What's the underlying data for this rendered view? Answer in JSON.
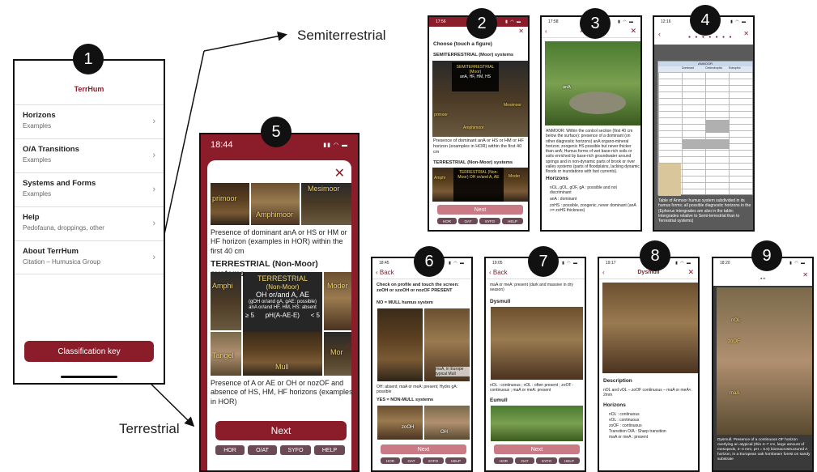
{
  "captions": {
    "semiterrestrial": "Semiterrestrial",
    "terrestrial": "Terrestrial"
  },
  "badges": [
    "1",
    "2",
    "3",
    "4",
    "5",
    "6",
    "7",
    "8",
    "9"
  ],
  "phone1": {
    "app_title": "TerrHum",
    "menu": [
      {
        "title": "Horizons",
        "subtitle": "Examples"
      },
      {
        "title": "O/A Transitions",
        "subtitle": "Examples"
      },
      {
        "title": "Systems and Forms",
        "subtitle": "Examples"
      },
      {
        "title": "Help",
        "subtitle": "Pedofauna, droppings, other"
      },
      {
        "title": "About TerrHum",
        "subtitle": "Citation – Humusica Group"
      }
    ],
    "classification_button": "Classification key"
  },
  "phone5": {
    "time": "18:44",
    "photo_labels": {
      "primoor": "primoor",
      "amphimoor": "Amphimoor",
      "mesimoor": "Mesimoor"
    },
    "moor_caption": "Presence of dominant anA or HS or HM or HF horizon (examples in HOR) within the first 40 cm",
    "terrestrial_title": "TERRESTRIAL (Non-Moor) systems",
    "overlay": {
      "l1": "TERRESTRIAL",
      "l2": "(Non-Moor)",
      "l3": "OH or/and A, AE",
      "l4": "(gOH or/and gA, gAE: possible)",
      "l5": "anA or/and HF, HM, HS: absent",
      "l6a": "≥ 5",
      "l6b": "pH(A-AE-E)",
      "l6c": "< 5"
    },
    "terr_labels": {
      "amphi": "Amphi",
      "moder": "Moder",
      "tangel": "Tangel",
      "mull": "Mull",
      "mor": "Mor"
    },
    "terr_caption": "Presence of A or AE or OH or nozOF and absence of HS, HM, HF horizons (examples in HOR)",
    "next_label": "Next",
    "tabs": [
      "HOR",
      "O/AT",
      "SYFO",
      "HELP"
    ]
  },
  "phone2": {
    "time": "17:56",
    "choose": "Choose (touch a figure)",
    "semi_title": "SEMITERRESTRIAL (Moor) systems",
    "overlay": "SEMITERRESTRIAL (Moor)",
    "overlay_sub": "anA, HF, HM, HS",
    "moor_caption": "Presence of dominant anA or HS or HM or HF horizon (examples in HOR) within the first 40 cm",
    "terr_title": "TERRESTRIAL (Non-Moor) systems",
    "terr_overlay": "TERRESTRIAL (Non-Moor) OH or/and A, AE",
    "labels": {
      "amphi": "Amphi",
      "moder": "Moder",
      "mor": "Mor",
      "primoor": "primoor",
      "mesimoor": "Mesimoor",
      "amphimoor": "Amphimoor"
    },
    "next_label": "Next",
    "tabs": [
      "HOR",
      "OAT",
      "SYFO",
      "HELP"
    ]
  },
  "phone3": {
    "time": "17:58",
    "title": "Anmoor",
    "photo_label": "anA",
    "description": "ANMOOR: Within the control section (first 40 cm below the surface): presence of a dominant (on other diagnostic horizons) anA organo-mineral horizon; zoogenic HS possible but never thicker than anA; Humus forms of wet base-rich soils or soils enriched by base-rich groundwater around springs and in non-dynamic parts of brook or river valley systems (parts of floodplains, lacking dynamic floods or inundations with fast currents).",
    "horizons_title": "Horizons",
    "horizons": [
      "nOL, gOL, gOF, gA : possible and not discriminant",
      "anA : dominant",
      "zoHS : possible, zoogenic, never dominant (anA >= zoHS thickness)"
    ]
  },
  "phone4": {
    "time": "12:16",
    "table_header": "ANMOOR",
    "columns": [
      "Dominant",
      "Ombrotrophic",
      "Eutrophic"
    ],
    "caption": "Table of Anmoor humus system subdivided in its humus forms; all possible diagnostic horizons in the (Ephorus intergrades are also in the table; Intergrades relative to Semi-terrestrial than to Terrestrial systems)"
  },
  "phone6": {
    "time": "18:45",
    "back": "Back",
    "instruction": "Check on profile and touch the screen: zoOH or szoOH or nozOF PRESENT",
    "no_title": "NO = MULL humus system",
    "label_mull": "maA, in Europe typical Mull",
    "no_caption": "OH: absent; maA or meA: present; Hydro gA: possible",
    "yes_title": "YES = NON-MULL systems",
    "yes_labels": {
      "zooh": "zoOH",
      "oh": "OH"
    },
    "next_label": "Next",
    "tabs": [
      "HOR",
      "OAT",
      "SYFO",
      "HELP"
    ]
  },
  "phone7": {
    "time": "19:05",
    "back": "Back",
    "top_text": "maA or meA: present (dark and massive in dry season)",
    "dysmull": "Dysmull",
    "dysmull_caption": "nOL : continuous ; vOL : often present ; zoOF : continuous ; maA or meA: present",
    "eumull": "Eumull",
    "next_label": "Next",
    "tabs": [
      "HOR",
      "OAT",
      "SYFO",
      "HELP"
    ]
  },
  "phone8": {
    "time": "19:17",
    "title": "Dysmull",
    "description_title": "Description",
    "description": "nOL and vOL – zoOF continuous – maA or meA< 2mm",
    "horizons_title": "Horizons",
    "horizons": [
      "nOL : continuous",
      "vOL : continuous",
      "zoOF : continuous",
      "Transition O/A : Sharp transition",
      "maA or meA : present"
    ]
  },
  "phone9": {
    "time": "18:20",
    "labels": {
      "nol": "nOL",
      "zoof": "zoOF",
      "maa": "maA"
    },
    "caption": "Dysmull. Presence of a continuous OF horizon overlying an atypical (thin 4–7 cm, large amount of mesopeds, 2–4 mm, pH = 5.0) biomacrostructured A horizon, in a European oak hornbeam forest on sandy substrate"
  },
  "colors": {
    "accent": "#8b1d2b",
    "tab": "#6b4a55",
    "overlay_text": "#f1d46a"
  }
}
